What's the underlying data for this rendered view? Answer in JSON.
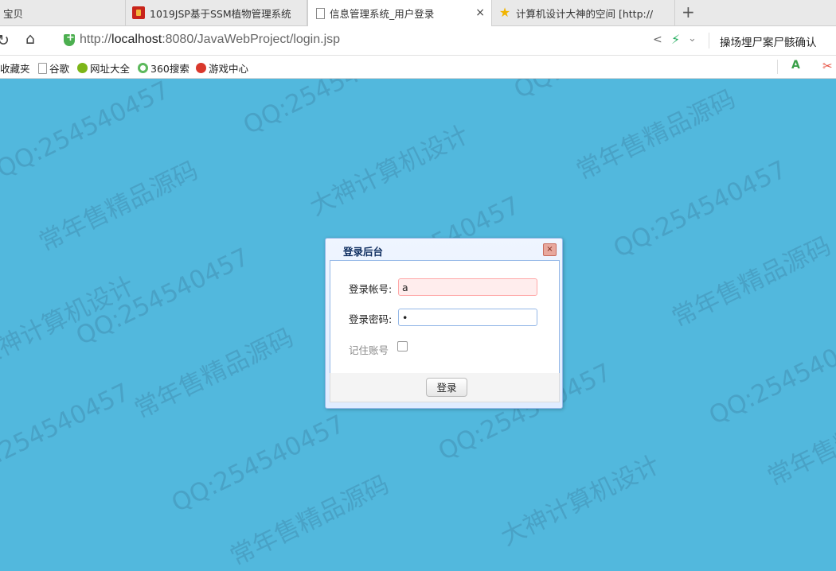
{
  "tabs": [
    {
      "label": "宝贝",
      "icon": "none"
    },
    {
      "label": "1019JSP基于SSM植物管理系统",
      "icon": "gift-icon"
    },
    {
      "label": "信息管理系统_用户登录",
      "icon": "page-icon",
      "active": true,
      "close": "×"
    },
    {
      "label": "计算机设计大神的空间 [http://",
      "icon": "star-icon"
    }
  ],
  "new_tab": "+",
  "address_bar": {
    "url_prefix": "http://",
    "url_host": "localhost",
    "url_rest": ":8080/JavaWebProject/login.jsp",
    "search_text": "操场埋尸案尸骸确认"
  },
  "bookmarks": [
    {
      "label": "收藏夹",
      "icon": "none"
    },
    {
      "label": "谷歌",
      "icon": "doc-icon"
    },
    {
      "label": "网址大全",
      "icon": "globe-icon"
    },
    {
      "label": "360搜索",
      "icon": "ring-icon"
    },
    {
      "label": "游戏中心",
      "icon": "game-icon"
    }
  ],
  "dialog": {
    "title": "登录后台",
    "close": "×",
    "account_label": "登录帐号:",
    "account_value": "a",
    "password_label": "登录密码:",
    "password_value": "•",
    "remember_label": "记住账号",
    "remember_checked": false,
    "login_button": "登录"
  },
  "watermarks": {
    "qq": "QQ:254540457",
    "shop": "常年售精品源码",
    "design": "大神计算机设计"
  },
  "colors": {
    "page_bg": "#52b8dd",
    "dialog_border": "#95b8e7",
    "error_field_bg": "#ffeded"
  }
}
